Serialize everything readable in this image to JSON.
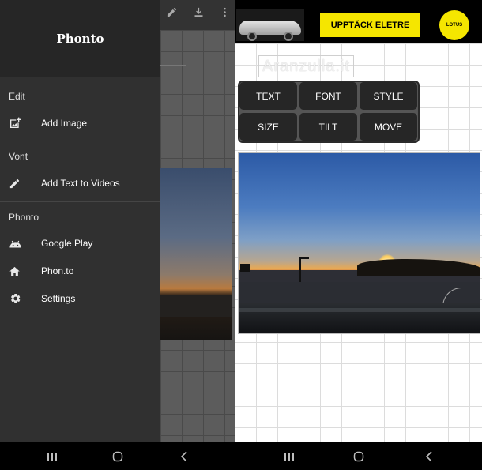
{
  "left": {
    "app_title": "Phonto",
    "sections": [
      {
        "label": "Edit",
        "items": [
          {
            "label": "Add Image",
            "icon": "add-photo-icon"
          }
        ]
      },
      {
        "label": "Vont",
        "items": [
          {
            "label": "Add Text to Videos",
            "icon": "pencil-icon"
          }
        ]
      },
      {
        "label": "Phonto",
        "items": [
          {
            "label": "Google Play",
            "icon": "android-icon"
          },
          {
            "label": "Phon.to",
            "icon": "home-icon"
          },
          {
            "label": "Settings",
            "icon": "gear-icon"
          }
        ]
      }
    ],
    "toolbar_icons": [
      "pencil-icon",
      "download-icon",
      "more-vert-icon"
    ],
    "nav": [
      "recent-apps-icon",
      "home-icon",
      "back-icon"
    ]
  },
  "right": {
    "ad": {
      "cta": "UPPTÄCK ELETRE",
      "brand": "LOTUS"
    },
    "text_object": "Aranzulla.it",
    "tools": [
      "TEXT",
      "FONT",
      "STYLE",
      "SIZE",
      "TILT",
      "MOVE"
    ],
    "nav": [
      "recent-apps-icon",
      "home-icon",
      "back-icon"
    ]
  },
  "colors": {
    "drawer_bg": "#303030",
    "drawer_header": "#262626",
    "ad_cta": "#f5e600",
    "tool_btn": "#262626"
  }
}
